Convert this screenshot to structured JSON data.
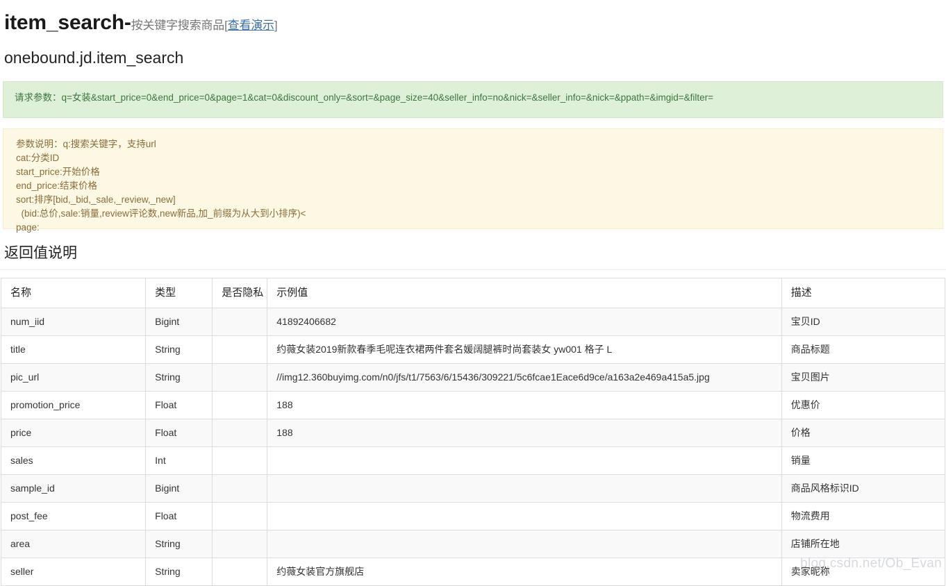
{
  "header": {
    "title_main": "item_search-",
    "title_sub": "按关键字搜索商品[",
    "title_link": "查看演示",
    "title_sub_close": "]",
    "api_name": "onebound.jd.item_search"
  },
  "request_box": {
    "text": "请求参数：q=女装&start_price=0&end_price=0&page=1&cat=0&discount_only=&sort=&page_size=40&seller_info=no&nick=&seller_info=&nick=&ppath=&imgid=&filter="
  },
  "params_box": {
    "lines": [
      "参数说明：q:搜索关键字，支持url",
      "cat:分类ID",
      "start_price:开始价格",
      "end_price:结束价格",
      "sort:排序[bid,_bid,_sale,_review,_new]",
      "  (bid:总价,sale:销量,review评论数,new新品,加_前缀为从大到小排序)<",
      "page:"
    ]
  },
  "return_section": {
    "title": "返回值说明",
    "columns": [
      "名称",
      "类型",
      "是否隐私",
      "示例值",
      "描述"
    ],
    "rows": [
      {
        "name": "num_iid",
        "type": "Bigint",
        "private": "",
        "example": "41892406682",
        "desc": "宝贝ID"
      },
      {
        "name": "title",
        "type": "String",
        "private": "",
        "example": "约薇女装2019新款春季毛呢连衣裙两件套名媛阔腿裤时尚套装女 yw001 格子 L",
        "desc": "商品标题"
      },
      {
        "name": "pic_url",
        "type": "String",
        "private": "",
        "example": "//img12.360buyimg.com/n0/jfs/t1/7563/6/15436/309221/5c6fcae1Eace6d9ce/a163a2e469a415a5.jpg",
        "desc": "宝贝图片"
      },
      {
        "name": "promotion_price",
        "type": "Float",
        "private": "",
        "example": "188",
        "desc": "优惠价"
      },
      {
        "name": "price",
        "type": "Float",
        "private": "",
        "example": "188",
        "desc": "价格"
      },
      {
        "name": "sales",
        "type": "Int",
        "private": "",
        "example": "",
        "desc": "销量"
      },
      {
        "name": "sample_id",
        "type": "Bigint",
        "private": "",
        "example": "",
        "desc": "商品风格标识ID"
      },
      {
        "name": "post_fee",
        "type": "Float",
        "private": "",
        "example": "",
        "desc": "物流费用"
      },
      {
        "name": "area",
        "type": "String",
        "private": "",
        "example": "",
        "desc": "店铺所在地"
      },
      {
        "name": "seller",
        "type": "String",
        "private": "",
        "example": "约薇女装官方旗舰店",
        "desc": "卖家昵称"
      }
    ]
  },
  "watermark": {
    "text": "blog.csdn.net/Ob_Evan"
  },
  "colors": {
    "request_bg": "#dff0d8",
    "request_text": "#3c763d",
    "params_bg": "#fcf8e3",
    "params_text": "#8a6d3b",
    "link": "#3b6ea8",
    "row_alt_bg": "#f9f9f9",
    "border": "#dddddd"
  }
}
